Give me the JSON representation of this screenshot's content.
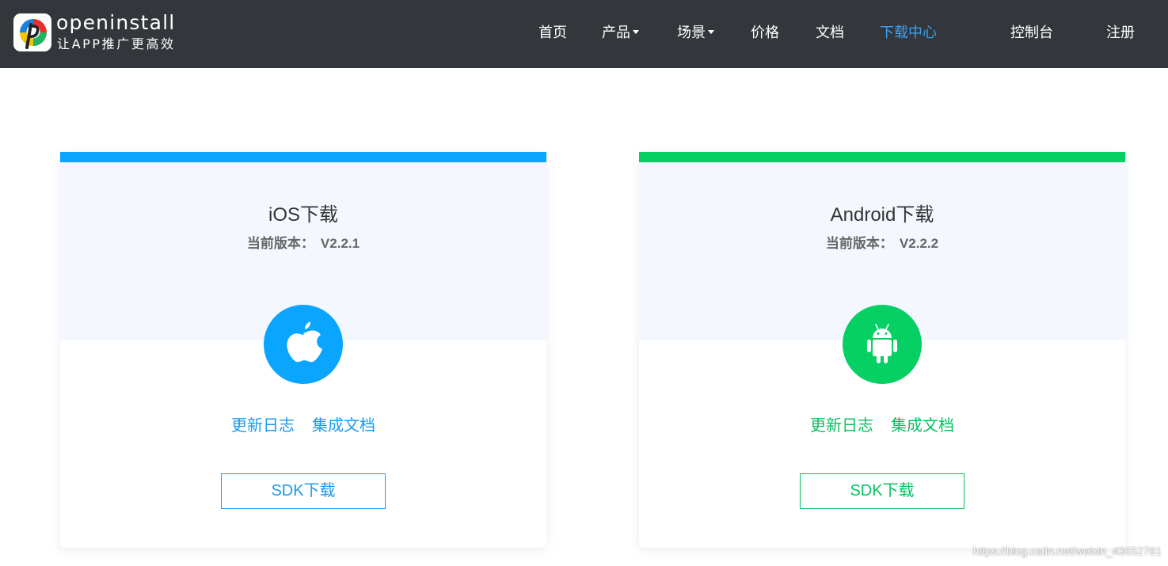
{
  "header": {
    "brand_name": "openinstall",
    "slogan": "让APP推广更高效",
    "nav": [
      {
        "label": "首页",
        "dropdown": false,
        "active": false
      },
      {
        "label": "产品",
        "dropdown": true,
        "active": false
      },
      {
        "label": "场景",
        "dropdown": true,
        "active": false
      },
      {
        "label": "价格",
        "dropdown": false,
        "active": false
      },
      {
        "label": "文档",
        "dropdown": false,
        "active": false
      },
      {
        "label": "下载中心",
        "dropdown": false,
        "active": true
      }
    ],
    "console_label": "控制台",
    "register_label": "注册"
  },
  "cards": {
    "ios": {
      "title": "iOS下载",
      "version_label": "当前版本：",
      "version_value": "V2.2.1",
      "icon": "apple-icon",
      "changelog_label": "更新日志",
      "docs_label": "集成文档",
      "sdk_button_label": "SDK下载",
      "accent_color": "#0aa5ff"
    },
    "android": {
      "title": "Android下载",
      "version_label": "当前版本：",
      "version_value": "V2.2.2",
      "icon": "android-icon",
      "changelog_label": "更新日志",
      "docs_label": "集成文档",
      "sdk_button_label": "SDK下载",
      "accent_color": "#06cf63"
    }
  },
  "watermark": "https://blog.csdn.net/weixin_43652781",
  "colors": {
    "header_bg": "#33373b",
    "nav_active": "#3aa0f2",
    "card_head_bg": "#f4f8fe"
  }
}
